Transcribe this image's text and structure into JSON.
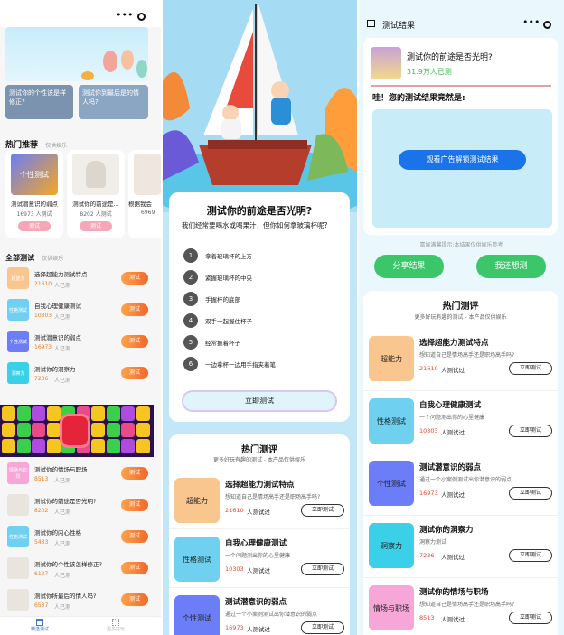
{
  "p1": {
    "banner_captions": [
      "测试你的个性该是样修正?",
      "测试你到最后是的情人吗?"
    ],
    "hot_title": "热门推荐",
    "hot_sub": "仅供娱乐",
    "hot_cards": [
      {
        "thumb": "个性测试",
        "title": "测试潜意识的弱点",
        "count": "16973 人测试",
        "btn": "测试"
      },
      {
        "thumb": "",
        "title": "测试你的前途是...",
        "count": "8202 人测试",
        "btn": "测试"
      },
      {
        "thumb": "",
        "title": "根据我会",
        "count": "6969",
        "btn": ""
      }
    ],
    "all_title": "全部测试",
    "all_sub": "仅供娱乐",
    "list": [
      {
        "thumb": "超能力",
        "title": "选择超能力测试特点",
        "count": "21610",
        "suffix": "人已测",
        "btn": "测试"
      },
      {
        "thumb": "性格测试",
        "title": "自我心理健康测试",
        "count": "10303",
        "suffix": "人已测",
        "btn": "测试"
      },
      {
        "thumb": "个性测试",
        "title": "测试潜意识的弱点",
        "count": "16973",
        "suffix": "人已测",
        "btn": "测试"
      },
      {
        "thumb": "洞察力",
        "title": "测试你的洞察力",
        "count": "7236",
        "suffix": "人已测",
        "btn": "测试"
      }
    ],
    "list2": [
      {
        "thumb": "情场与职场",
        "title": "测试你的情场与职场",
        "count": "8513",
        "suffix": "人已测",
        "btn": "测试"
      },
      {
        "thumb": "",
        "title": "测试你的前途是否光明?",
        "count": "8202",
        "suffix": "人已测",
        "btn": "测试"
      },
      {
        "thumb": "性格测试",
        "title": "测试你的内心性格",
        "count": "5433",
        "suffix": "人已测",
        "btn": "测试"
      },
      {
        "thumb": "",
        "title": "测试你的个性该怎样修正?",
        "count": "6127",
        "suffix": "人已测",
        "btn": "测试"
      },
      {
        "thumb": "",
        "title": "测试你所最后的情人吗?",
        "count": "6537",
        "suffix": "人已测",
        "btn": "测试"
      }
    ],
    "tabbar": [
      {
        "label": "精选测试",
        "icon": "home-icon"
      },
      {
        "label": "更多好玩",
        "icon": "grid-icon"
      }
    ]
  },
  "p2": {
    "title": "测试你的前途是否光明?",
    "question": "我们经常要喝水或喝果汁，但你如何拿玻璃杯呢?",
    "options": [
      {
        "num": "1",
        "text": "拿着玻璃杯的上方"
      },
      {
        "num": "2",
        "text": "紧握玻璃杯的中央"
      },
      {
        "num": "3",
        "text": "手握杯的底部"
      },
      {
        "num": "4",
        "text": "双手一起握住杯子"
      },
      {
        "num": "5",
        "text": "经常握着杯子"
      },
      {
        "num": "6",
        "text": "一边拿杯一边用手指夹着笔"
      }
    ],
    "start_btn": "立即测试",
    "hot_title": "热门测评",
    "hot_sub": "更多好玩有趣的测试 - 本产品仅供娱乐",
    "items": [
      {
        "thumb": "超能力",
        "title": "选择超能力测试特点",
        "desc": "想知道自己是情场高手还是职场高手吗?",
        "count": "21610",
        "suffix": "人测试过",
        "btn": "立即测试"
      },
      {
        "thumb": "性格测试",
        "title": "自我心理健康测试",
        "desc": "一个问题测出你的心里健康",
        "count": "10303",
        "suffix": "人测试过",
        "btn": "立即测试"
      },
      {
        "thumb": "个性测试",
        "title": "测试潜意识的弱点",
        "desc": "通过一个小案例测试出你潜意识的弱点",
        "count": "16973",
        "suffix": "人测试过",
        "btn": "立即测试"
      }
    ]
  },
  "p3": {
    "nav_title": "测试结果",
    "quiz_title": "测试你的前途是否光明?",
    "quiz_count": "31.9万人已测",
    "reveal": "哇！您的测试结果竟然是:",
    "unlock_btn": "观看广告解锁测试结果",
    "disclaimer": "富娱满馨提示:本结果仅供娱乐参考",
    "share_btn": "分享结果",
    "again_btn": "我还想测",
    "hot_title": "热门测评",
    "hot_sub": "更多好玩有趣的测试 - 本产品仅供娱乐",
    "items": [
      {
        "thumb": "超能力",
        "title": "选择超能力测试特点",
        "desc": "想知道自己是情场高手还是职场高手吗?",
        "count": "21610",
        "suffix": "人测试过",
        "btn": "立即测试"
      },
      {
        "thumb": "性格测试",
        "title": "自我心理健康测试",
        "desc": "一个问题测出你的心里健康",
        "count": "10303",
        "suffix": "人测试过",
        "btn": "立即测试"
      },
      {
        "thumb": "个性测试",
        "title": "测试潜意识的弱点",
        "desc": "通过一个小案例测试出你潜意识的弱点",
        "count": "16973",
        "suffix": "人测试过",
        "btn": "立即测试"
      },
      {
        "thumb": "洞察力",
        "title": "测试你的洞察力",
        "desc": "洞察力测试",
        "count": "7236",
        "suffix": "人测试过",
        "btn": "立即测试"
      },
      {
        "thumb": "情场与职场",
        "title": "测试你的情场与职场",
        "desc": "想知道自己是情场高手还是职场高手吗?",
        "count": "8513",
        "suffix": "人测试过",
        "btn": "立即测试"
      }
    ]
  },
  "colors": {
    "orange": "#f07a1a",
    "green": "#3cc66a",
    "blue": "#1a73e8",
    "pink": "#f9a7c7",
    "cyan": "#6fd0f0"
  }
}
